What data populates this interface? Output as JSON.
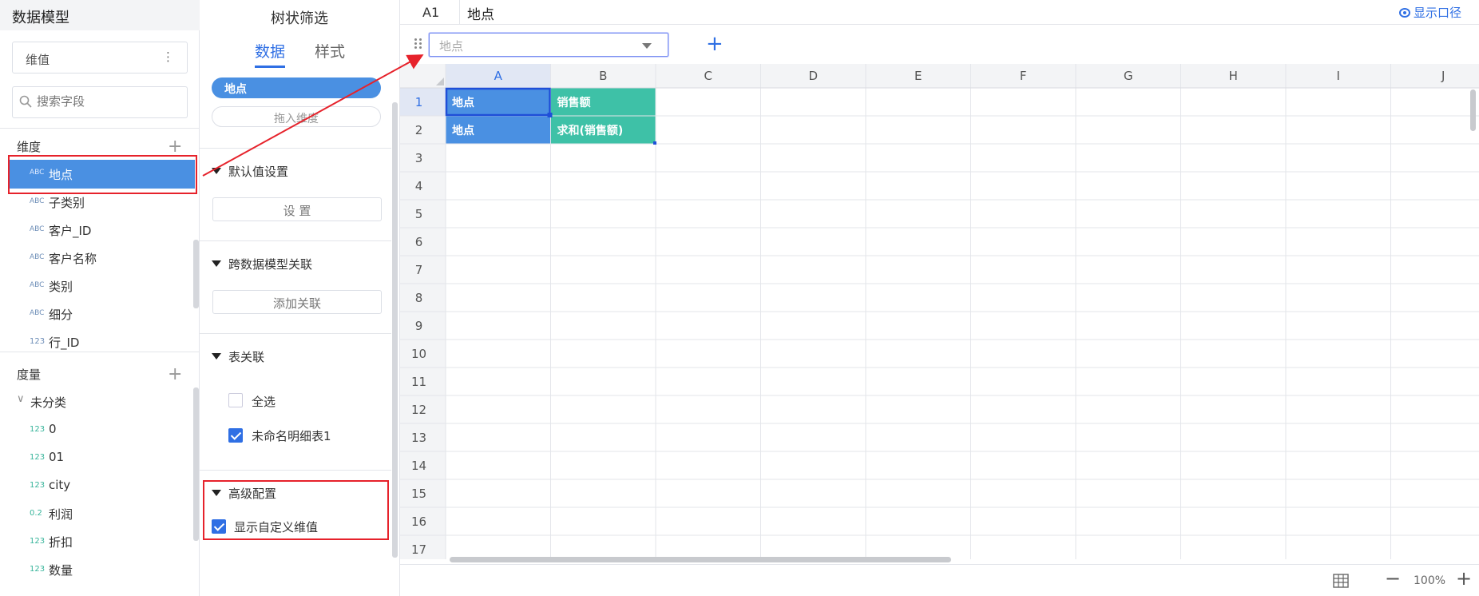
{
  "left": {
    "title": "数据模型",
    "dim_select": "维值",
    "search_placeholder": "搜索字段",
    "dimension_header": "维度",
    "dimensions": [
      {
        "type": "ABC",
        "label": "地点"
      },
      {
        "type": "ABC",
        "label": "子类别"
      },
      {
        "type": "ABC",
        "label": "客户_ID"
      },
      {
        "type": "ABC",
        "label": "客户名称"
      },
      {
        "type": "ABC",
        "label": "类别"
      },
      {
        "type": "ABC",
        "label": "细分"
      },
      {
        "type": "123",
        "label": "行_ID"
      }
    ],
    "measure_header": "度量",
    "measure_group": "未分类",
    "measures": [
      {
        "type": "123",
        "label": "0"
      },
      {
        "type": "123",
        "label": "01"
      },
      {
        "type": "123",
        "label": "city"
      },
      {
        "type": "0.2",
        "label": "利润"
      },
      {
        "type": "123",
        "label": "折扣"
      },
      {
        "type": "123",
        "label": "数量"
      }
    ]
  },
  "mid": {
    "title": "树状筛选",
    "tab_data": "数据",
    "tab_style": "样式",
    "pill": "地点",
    "pill_drop": "拖入维度",
    "sec_default": "默认值设置",
    "btn_set": "设 置",
    "sec_cross": "跨数据模型关联",
    "btn_add_rel": "添加关联",
    "sec_table": "表关联",
    "chk_all": "全选",
    "chk_table": "未命名明细表1",
    "sec_adv": "高级配置",
    "chk_custom": "显示自定义维值"
  },
  "right": {
    "namebox": "A1",
    "formula": "地点",
    "show_caliber": "显示口径",
    "combo_placeholder": "地点",
    "columns": [
      "A",
      "B",
      "C",
      "D",
      "E",
      "F",
      "G",
      "H",
      "I",
      "J"
    ],
    "rows": [
      "1",
      "2",
      "3",
      "4",
      "5",
      "6",
      "7",
      "8",
      "9",
      "10",
      "11",
      "12",
      "13",
      "14",
      "15",
      "16",
      "17"
    ],
    "cells": {
      "A1": "地点",
      "B1": "销售额",
      "A2": "地点",
      "B2": "求和(销售额)"
    },
    "zoom": "100%",
    "colors": {
      "dim_cell": "#4a90e2",
      "measure_cell": "#3ec1a7",
      "accent": "#2f6fe4",
      "highlight": "#e6222b"
    }
  }
}
